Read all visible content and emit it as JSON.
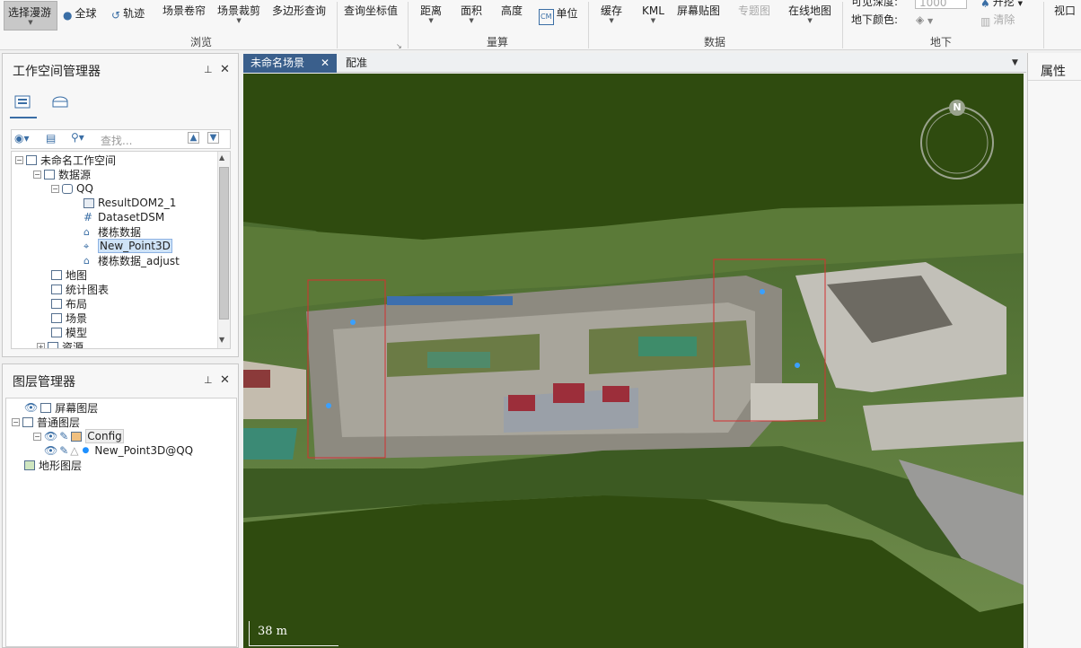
{
  "ribbon": {
    "browse": {
      "select_roam": "选择漫游",
      "globe": "全球",
      "orbit": "轨迹",
      "scene_roll": "场景卷帘",
      "scene_clip": "场景裁剪",
      "polygon_query": "多边形查询",
      "group": "浏览"
    },
    "query_coords": "查询坐标值",
    "measure": {
      "distance": "距离",
      "area": "面积",
      "height": "高度",
      "unit": "单位",
      "group": "量算"
    },
    "data": {
      "cache": "缓存",
      "kml": "KML",
      "screen_map": "屏幕贴图",
      "thematic": "专题图",
      "online_map": "在线地图",
      "group": "数据"
    },
    "underground": {
      "visible_depth": "可见深度:",
      "depth_value": "1000",
      "ground_color": "地下颜色:",
      "excavate": "开挖",
      "clear": "清除",
      "group": "地下"
    },
    "view": "视口"
  },
  "workspace": {
    "title": "工作空间管理器",
    "pin": "ᵖ",
    "close": "✕",
    "search_placeholder": "查找...",
    "tree": {
      "root": "未命名工作空间",
      "datasources": "数据源",
      "ds": "QQ",
      "items": [
        "ResultDOM2_1",
        "DatasetDSM",
        "楼栋数据",
        "New_Point3D",
        "楼栋数据_adjust"
      ],
      "others": [
        "地图",
        "统计图表",
        "布局",
        "场景",
        "模型",
        "资源"
      ]
    }
  },
  "layers": {
    "title": "图层管理器",
    "pin": "ᵖ",
    "close": "✕",
    "screen": "屏幕图层",
    "normal": "普通图层",
    "config": "Config",
    "point": "New_Point3D@QQ",
    "terrain": "地形图层"
  },
  "tabs": {
    "scene": "未命名场景",
    "close": "✕",
    "config": "配准",
    "dropdown": "▼"
  },
  "scene": {
    "compass": "N",
    "scale": "38 m"
  },
  "properties": {
    "title": "属性"
  }
}
